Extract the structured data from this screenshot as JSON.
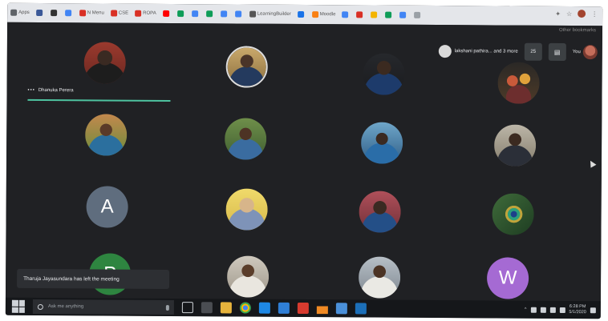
{
  "bookmarks": [
    {
      "label": "Apps",
      "icon": "apps-icon",
      "color": "#5f6368"
    },
    {
      "label": "",
      "icon": "facebook-icon",
      "color": "#3b5998"
    },
    {
      "label": "",
      "icon": "github-icon",
      "color": "#333333"
    },
    {
      "label": "",
      "icon": "app-icon",
      "color": "#4285f4"
    },
    {
      "label": "N Menu",
      "icon": "gmail-icon",
      "color": "#d93025"
    },
    {
      "label": "CSE",
      "icon": "gmail-icon",
      "color": "#d93025"
    },
    {
      "label": "ROPA",
      "icon": "gmail-icon",
      "color": "#d93025"
    },
    {
      "label": "",
      "icon": "youtube-icon",
      "color": "#ff0000"
    },
    {
      "label": "",
      "icon": "drive-icon",
      "color": "#0f9d58"
    },
    {
      "label": "",
      "icon": "docs-icon",
      "color": "#4285f4"
    },
    {
      "label": "",
      "icon": "sheets-icon",
      "color": "#0f9d58"
    },
    {
      "label": "",
      "icon": "calendar-icon",
      "color": "#4285f4"
    },
    {
      "label": "",
      "icon": "bookmark-icon",
      "color": "#4285f4"
    },
    {
      "label": "LearningBuilder",
      "icon": "download-icon",
      "color": "#555555"
    },
    {
      "label": "",
      "icon": "web-icon",
      "color": "#1a73e8"
    },
    {
      "label": "Moodle",
      "icon": "moodle-icon",
      "color": "#f98012"
    },
    {
      "label": "",
      "icon": "app-icon",
      "color": "#4285f4"
    },
    {
      "label": "",
      "icon": "app-icon",
      "color": "#d93025"
    },
    {
      "label": "",
      "icon": "app-icon",
      "color": "#f4b400"
    },
    {
      "label": "",
      "icon": "app-icon",
      "color": "#0f9d58"
    },
    {
      "label": "",
      "icon": "app-icon",
      "color": "#4285f4"
    },
    {
      "label": "",
      "icon": "app-icon",
      "color": "#9aa0a6"
    }
  ],
  "other_bookmarks": "Other bookmarks",
  "meeting": {
    "speaker_name": "Dhanuka Perera",
    "others_chip": "lakshani pathira... and 3 more",
    "people_count": "25",
    "you_label": "You",
    "toast": "Tharuja Jayasundara has left the meeting",
    "letter_tiles": [
      "A",
      "P",
      "W"
    ],
    "letter_colors": {
      "A": "#5f6d7e",
      "P": "#2e8540",
      "W": "#a56ad3"
    }
  },
  "taskbar": {
    "search_placeholder": "Ask me anything",
    "time": "6:28 PM",
    "date": "5/1/2020"
  }
}
